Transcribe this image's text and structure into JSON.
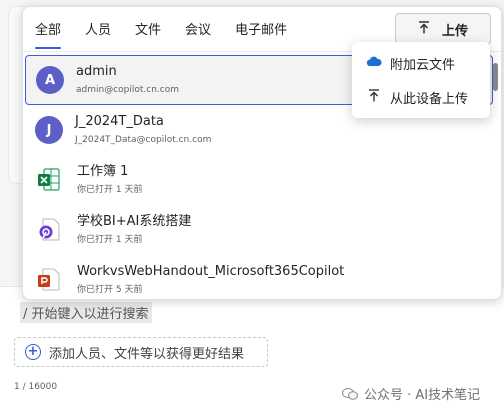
{
  "tabs": [
    {
      "label": "全部",
      "active": true
    },
    {
      "label": "人员"
    },
    {
      "label": "文件"
    },
    {
      "label": "会议"
    },
    {
      "label": "电子邮件"
    }
  ],
  "upload_button": {
    "label": "上传",
    "icon": "upload-arrow-icon"
  },
  "upload_menu": [
    {
      "label": "附加云文件",
      "icon": "cloud-icon"
    },
    {
      "label": "从此设备上传",
      "icon": "upload-arrow-icon"
    }
  ],
  "results": [
    {
      "kind": "person",
      "initial": "A",
      "title": "admin",
      "subtitle": "admin@copilot.cn.com",
      "selected": true
    },
    {
      "kind": "person",
      "initial": "J",
      "title": "J_2024T_Data",
      "subtitle": "J_2024T_Data@copilot.cn.com"
    },
    {
      "kind": "excel",
      "title": "工作簿 1",
      "subtitle": "你已打开 1 天前"
    },
    {
      "kind": "loop",
      "title": "学校BI+AI系统搭建",
      "subtitle": "你已打开 1 天前"
    },
    {
      "kind": "powerpoint",
      "title": "WorkvsWebHandout_Microsoft365Copilot",
      "subtitle": "你已打开 5 天前"
    }
  ],
  "composer": {
    "hint": "/ 开始键入以进行搜索",
    "add_label": "添加人员、文件等以获得更好结果",
    "counter": "1 / 16000"
  },
  "watermark": "公众号 · AI技术笔记",
  "colors": {
    "accent": "#3b5fd9",
    "avatar": "#5b5fc7",
    "excel": "#107c41",
    "powerpoint": "#c43e1c",
    "loop": "#6b3dd6"
  }
}
